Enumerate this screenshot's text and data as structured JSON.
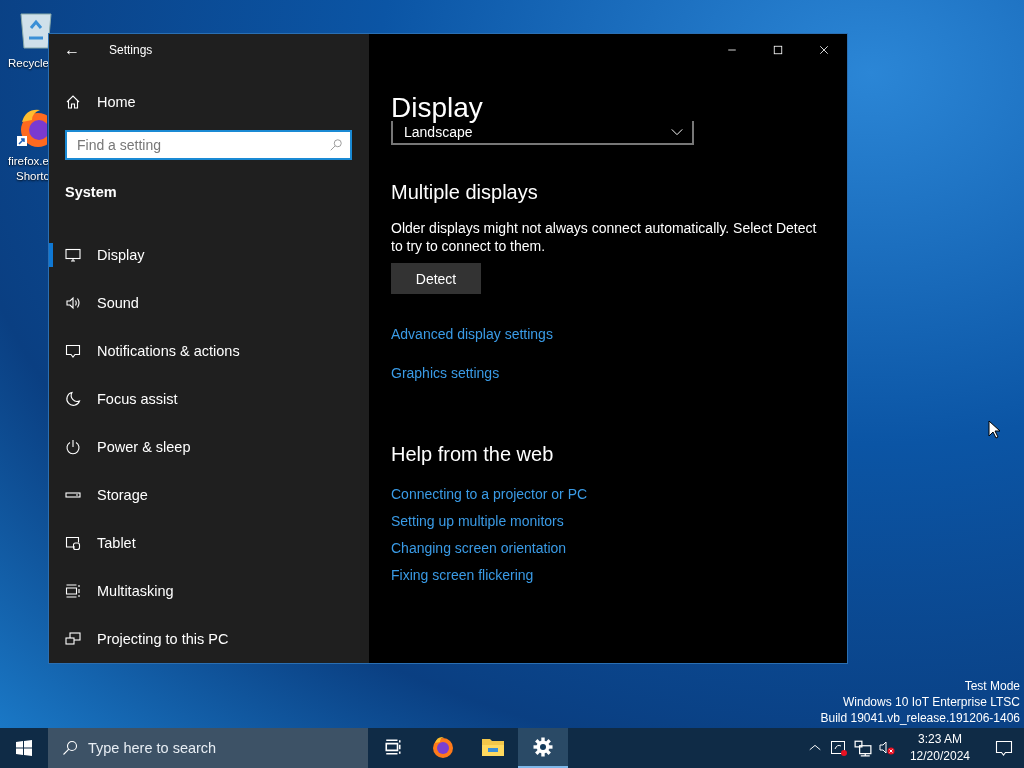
{
  "desktop": {
    "icons": [
      {
        "kind": "recycle",
        "labels": [
          "Recycle"
        ]
      },
      {
        "kind": "firefox",
        "labels": [
          "firefox.e",
          "Shortc"
        ]
      }
    ],
    "watermark": [
      "Test Mode",
      "Windows 10 IoT Enterprise LTSC",
      "Build 19041.vb_release.191206-1406"
    ]
  },
  "window": {
    "title": "Settings",
    "back": "←"
  },
  "sidebar": {
    "home": "Home",
    "search": {
      "placeholder": "Find a setting"
    },
    "section": "System",
    "items": [
      {
        "label": "Display",
        "kind": "display",
        "selected": true
      },
      {
        "label": "Sound",
        "kind": "sound",
        "selected": false
      },
      {
        "label": "Notifications & actions",
        "kind": "notifications",
        "selected": false
      },
      {
        "label": "Focus assist",
        "kind": "moon",
        "selected": false
      },
      {
        "label": "Power & sleep",
        "kind": "power",
        "selected": false
      },
      {
        "label": "Storage",
        "kind": "storage",
        "selected": false
      },
      {
        "label": "Tablet",
        "kind": "tablet",
        "selected": false
      },
      {
        "label": "Multitasking",
        "kind": "multitask",
        "selected": false
      },
      {
        "label": "Projecting to this PC",
        "kind": "project",
        "selected": false
      }
    ]
  },
  "content": {
    "title": "Display",
    "orientation_dropdown": {
      "value": "Landscape"
    },
    "multiple_displays": {
      "heading": "Multiple displays",
      "text": "Older displays might not always connect automatically. Select Detect to try to connect to them.",
      "button": "Detect"
    },
    "links": [
      "Advanced display settings",
      "Graphics settings"
    ],
    "help": {
      "heading": "Help from the web",
      "links": [
        "Connecting to a projector or PC",
        "Setting up multiple monitors",
        "Changing screen orientation",
        "Fixing screen flickering"
      ]
    }
  },
  "taskbar": {
    "search": {
      "placeholder": "Type here to search"
    },
    "apps": [
      {
        "kind": "taskview",
        "selected": false
      },
      {
        "kind": "firefox",
        "selected": false
      },
      {
        "kind": "folder",
        "selected": false
      },
      {
        "kind": "settings",
        "selected": true
      }
    ],
    "tray": [
      {
        "kind": "chevron"
      },
      {
        "kind": "tablet-alert"
      },
      {
        "kind": "network"
      },
      {
        "kind": "volume-muted"
      }
    ],
    "time": "3:23 AM",
    "date": "12/20/2024"
  }
}
